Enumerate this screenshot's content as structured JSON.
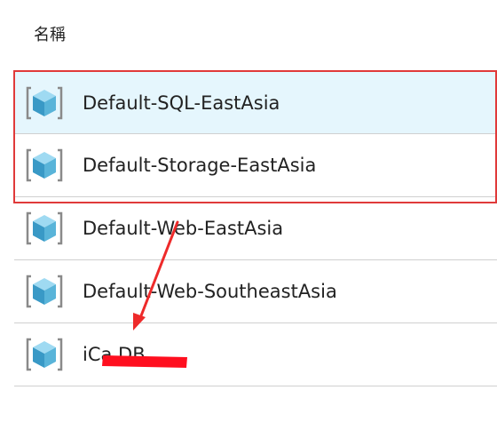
{
  "header": {
    "name_column": "名稱"
  },
  "resource_groups": [
    {
      "name": "Default-SQL-EastAsia",
      "icon": "resource-group-cube-icon",
      "selected": true
    },
    {
      "name": "Default-Storage-EastAsia",
      "icon": "resource-group-cube-icon",
      "selected": false
    },
    {
      "name": "Default-Web-EastAsia",
      "icon": "resource-group-cube-icon",
      "selected": false
    },
    {
      "name": "Default-Web-SoutheastAsia",
      "icon": "resource-group-cube-icon",
      "selected": false
    },
    {
      "name": "iCa DB",
      "icon": "resource-group-cube-icon",
      "selected": false
    }
  ],
  "colors": {
    "selected_row_bg": "#e5f6fd",
    "highlight_border": "#e03a3a",
    "arrow": "#ee2a2a",
    "redaction": "#ff0f1f",
    "icon_blue": "#59b4d9"
  }
}
